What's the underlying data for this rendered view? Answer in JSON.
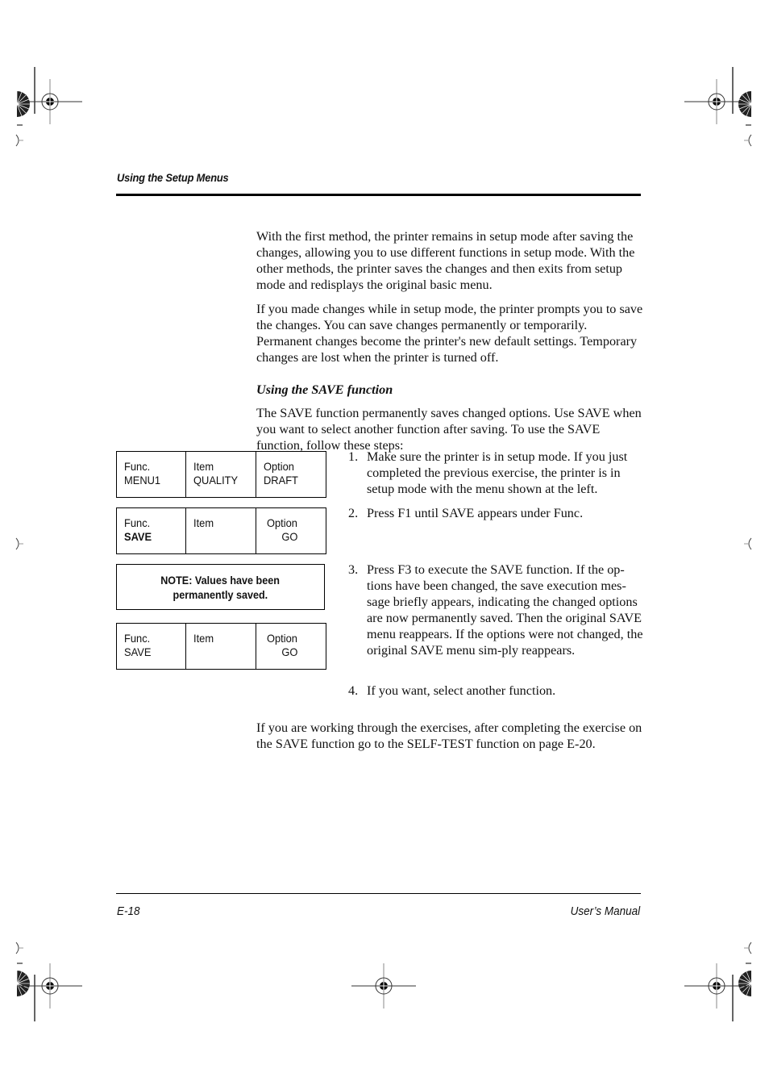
{
  "header": {
    "running_head": "Using the Setup Menus"
  },
  "body": {
    "paragraph_1": "With the first method, the printer remains in setup mode after saving the changes, allowing you to use different functions in setup mode. With the other methods, the printer saves the changes and then exits from setup mode and redisplays the original basic menu.",
    "paragraph_2": "If you made changes while in setup mode, the printer prompts you to save the changes. You can save changes permanently or temporarily. Permanent changes become the printer's new default settings. Temporary changes are lost when the printer is turned off.",
    "subheading": "Using the SAVE function",
    "paragraph_3": "The SAVE function permanently saves changed options. Use SAVE when you want to select another function after saving. To use the SAVE function, follow these steps:",
    "paragraph_4": "If you are working through the exercises, after completing the exercise on the SAVE function go to the SELF-TEST function on page E-20."
  },
  "steps": [
    {
      "number": "1.",
      "text": "Make sure the printer is in setup mode. If you just completed the previous exercise, the printer is in setup mode with the menu shown at the left."
    },
    {
      "number": "2.",
      "text": "Press F1 until SAVE appears under Func."
    },
    {
      "number": "3.",
      "text": "Press F3 to execute the SAVE function. If the op-tions have been changed, the save execution mes-sage briefly appears, indicating the changed options are now permanently saved. Then the original SAVE menu reappears. If the options were not changed, the original SAVE menu sim-ply reappears."
    },
    {
      "number": "4.",
      "text": "If you want, select another function."
    }
  ],
  "displays": {
    "display_1": {
      "func_label": "Func.",
      "func_value": "MENU1",
      "item_label": "Item",
      "item_value": "QUALITY",
      "option_label": "Option",
      "option_value": "DRAFT"
    },
    "display_2": {
      "func_label": "Func.",
      "func_value": "SAVE",
      "item_label": "Item",
      "item_value": "",
      "option_label": "Option",
      "option_value": "GO"
    },
    "note": {
      "line_1": "NOTE: Values have been",
      "line_2": "permanently saved."
    },
    "display_4": {
      "func_label": "Func.",
      "func_value": "SAVE",
      "item_label": "Item",
      "item_value": "",
      "option_label": "Option",
      "option_value": "GO"
    }
  },
  "footer": {
    "page_number": "E-18",
    "manual_title": "User’s Manual"
  }
}
